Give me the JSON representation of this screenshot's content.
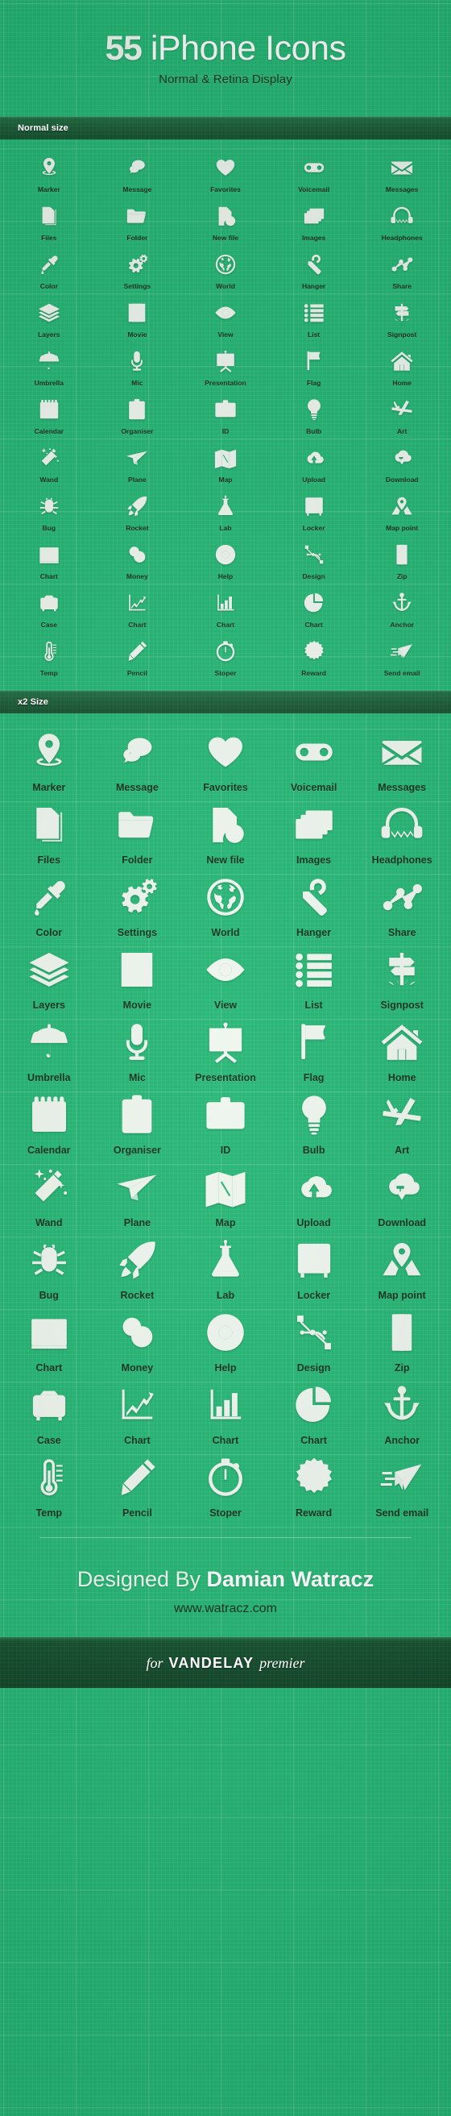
{
  "banner": {
    "count": "55",
    "title_rest": " iPhone Icons",
    "subtitle": "Normal & Retina Display"
  },
  "sections": [
    {
      "id": "normal",
      "bar_label": "Normal size"
    },
    {
      "id": "retina",
      "bar_label": "x2 Size"
    }
  ],
  "icons": [
    {
      "label": "Marker",
      "icon": "map-marker-icon"
    },
    {
      "label": "Message",
      "icon": "speech-bubbles-icon"
    },
    {
      "label": "Favorites",
      "icon": "heart-icon"
    },
    {
      "label": "Voicemail",
      "icon": "voicemail-icon"
    },
    {
      "label": "Messages",
      "icon": "envelope-icon"
    },
    {
      "label": "Files",
      "icon": "documents-icon"
    },
    {
      "label": "Folder",
      "icon": "folder-icon"
    },
    {
      "label": "New file",
      "icon": "new-file-plus-icon"
    },
    {
      "label": "Images",
      "icon": "photos-stack-icon"
    },
    {
      "label": "Headphones",
      "icon": "headphones-icon"
    },
    {
      "label": "Color",
      "icon": "eyedropper-icon"
    },
    {
      "label": "Settings",
      "icon": "gears-icon"
    },
    {
      "label": "World",
      "icon": "globe-icon"
    },
    {
      "label": "Hanger",
      "icon": "price-tag-icon"
    },
    {
      "label": "Share",
      "icon": "share-nodes-icon"
    },
    {
      "label": "Layers",
      "icon": "layers-icon"
    },
    {
      "label": "Movie",
      "icon": "film-strip-icon"
    },
    {
      "label": "View",
      "icon": "eye-icon"
    },
    {
      "label": "List",
      "icon": "bullet-list-icon"
    },
    {
      "label": "Signpost",
      "icon": "signpost-icon"
    },
    {
      "label": "Umbrella",
      "icon": "umbrella-icon"
    },
    {
      "label": "Mic",
      "icon": "microphone-icon"
    },
    {
      "label": "Presentation",
      "icon": "presentation-board-icon"
    },
    {
      "label": "Flag",
      "icon": "flag-icon"
    },
    {
      "label": "Home",
      "icon": "house-icon"
    },
    {
      "label": "Calendar",
      "icon": "calendar-icon"
    },
    {
      "label": "Organiser",
      "icon": "clipboard-icon"
    },
    {
      "label": "ID",
      "icon": "id-card-icon"
    },
    {
      "label": "Bulb",
      "icon": "lightbulb-icon"
    },
    {
      "label": "Art",
      "icon": "art-tools-icon"
    },
    {
      "label": "Wand",
      "icon": "magic-wand-icon"
    },
    {
      "label": "Plane",
      "icon": "paper-plane-icon"
    },
    {
      "label": "Map",
      "icon": "folded-map-icon"
    },
    {
      "label": "Upload",
      "icon": "cloud-upload-icon"
    },
    {
      "label": "Download",
      "icon": "cloud-download-icon"
    },
    {
      "label": "Bug",
      "icon": "bug-icon"
    },
    {
      "label": "Rocket",
      "icon": "rocket-icon"
    },
    {
      "label": "Lab",
      "icon": "flask-icon"
    },
    {
      "label": "Locker",
      "icon": "cabinet-icon"
    },
    {
      "label": "Map point",
      "icon": "map-pin-area-icon"
    },
    {
      "label": "Chart",
      "icon": "line-chart-frame-icon"
    },
    {
      "label": "Money",
      "icon": "coins-dollar-icon"
    },
    {
      "label": "Help",
      "icon": "life-ring-icon"
    },
    {
      "label": "Design",
      "icon": "bezier-path-icon"
    },
    {
      "label": "Zip",
      "icon": "zipper-icon"
    },
    {
      "label": "Case",
      "icon": "briefcase-check-icon"
    },
    {
      "label": "Chart",
      "icon": "line-graph-icon"
    },
    {
      "label": "Chart",
      "icon": "bar-graph-icon"
    },
    {
      "label": "Chart",
      "icon": "pie-chart-icon"
    },
    {
      "label": "Anchor",
      "icon": "anchor-icon"
    },
    {
      "label": "Temp",
      "icon": "thermometer-icon"
    },
    {
      "label": "Pencil",
      "icon": "pencil-icon"
    },
    {
      "label": "Stoper",
      "icon": "stopwatch-icon"
    },
    {
      "label": "Reward",
      "icon": "dollar-badge-icon"
    },
    {
      "label": "Send email",
      "icon": "send-email-icon"
    }
  ],
  "footer": {
    "credit_prefix": "Designed By ",
    "credit_name": "Damian Watracz",
    "url": "www.watracz.com",
    "brand_for": "for",
    "brand_name": "VANDELAY",
    "brand_suffix": "premier"
  },
  "colors": {
    "background_green": "#22b573",
    "dark_bar_green": "#14502e",
    "icon_white": "#eef6ee",
    "label_dark": "#12311c"
  }
}
